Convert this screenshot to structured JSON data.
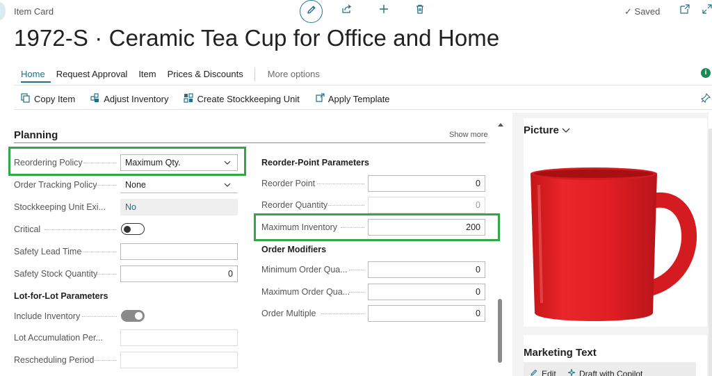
{
  "header": {
    "breadcrumb": "Item Card",
    "saved_label": "Saved",
    "title": "1972-S · Ceramic Tea Cup for Office and Home"
  },
  "tabs": [
    {
      "label": "Home",
      "active": true
    },
    {
      "label": "Request Approval"
    },
    {
      "label": "Item"
    },
    {
      "label": "Prices & Discounts"
    },
    {
      "label": "More options"
    }
  ],
  "actions": [
    {
      "label": "Copy Item",
      "icon": "copy-icon"
    },
    {
      "label": "Adjust Inventory",
      "icon": "adjust-inventory-icon"
    },
    {
      "label": "Create Stockkeeping Unit",
      "icon": "stockkeeping-unit-icon"
    },
    {
      "label": "Apply Template",
      "icon": "apply-template-icon"
    }
  ],
  "planning": {
    "title": "Planning",
    "show_more": "Show more",
    "left": {
      "reordering_policy": {
        "label": "Reordering Policy",
        "value": "Maximum Qty."
      },
      "order_tracking_policy": {
        "label": "Order Tracking Policy",
        "value": "None"
      },
      "sku_exists": {
        "label": "Stockkeeping Unit Exi...",
        "value": "No"
      },
      "critical": {
        "label": "Critical",
        "on": false
      },
      "safety_lead_time": {
        "label": "Safety Lead Time",
        "value": ""
      },
      "safety_stock_qty": {
        "label": "Safety Stock Quantity",
        "value": "0"
      },
      "lot_for_lot_header": "Lot-for-Lot Parameters",
      "include_inventory": {
        "label": "Include Inventory",
        "on": true
      },
      "lot_accumulation": {
        "label": "Lot Accumulation Per...",
        "value": ""
      },
      "rescheduling_period": {
        "label": "Rescheduling Period",
        "value": ""
      }
    },
    "right": {
      "reorder_point_header": "Reorder-Point Parameters",
      "reorder_point": {
        "label": "Reorder Point",
        "value": "0"
      },
      "reorder_quantity": {
        "label": "Reorder Quantity",
        "value": "0"
      },
      "maximum_inventory": {
        "label": "Maximum Inventory",
        "value": "200"
      },
      "order_modifiers_header": "Order Modifiers",
      "min_order_qty": {
        "label": "Minimum Order Qua...",
        "value": "0"
      },
      "max_order_qty": {
        "label": "Maximum Order Qua...",
        "value": "0"
      },
      "order_multiple": {
        "label": "Order Multiple",
        "value": "0"
      }
    }
  },
  "factbox": {
    "picture_title": "Picture",
    "marketing_title": "Marketing Text",
    "edit_label": "Edit",
    "copilot_label": "Draft with Copilot"
  },
  "colors": {
    "accent": "#1f6f8b",
    "highlight": "#33a645",
    "mug": "#e3262a"
  }
}
